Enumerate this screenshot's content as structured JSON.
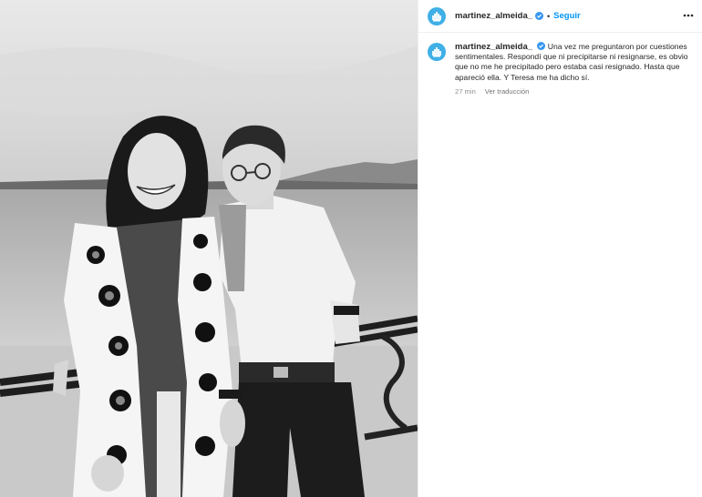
{
  "post": {
    "username": "martinez_almeida_",
    "follow_label": "Seguir",
    "separator": "•",
    "caption": "Una vez me preguntaron por cuestiones sentimentales. Respondí que ni precipitarse ni resignarse, es obvio que no me he precipitado pero estaba casi resignado. Hasta que apareció ella. Y Teresa me ha dicho sí.",
    "time_ago": "27 min",
    "translate_label": "Ver traducción"
  },
  "colors": {
    "accent": "#0095f6",
    "avatar_bg": "#3fb0e6",
    "verified": "#3897f0"
  },
  "icons": {
    "avatar": "city-emblem-icon",
    "verified": "verified-badge-icon",
    "more": "more-options-icon"
  }
}
